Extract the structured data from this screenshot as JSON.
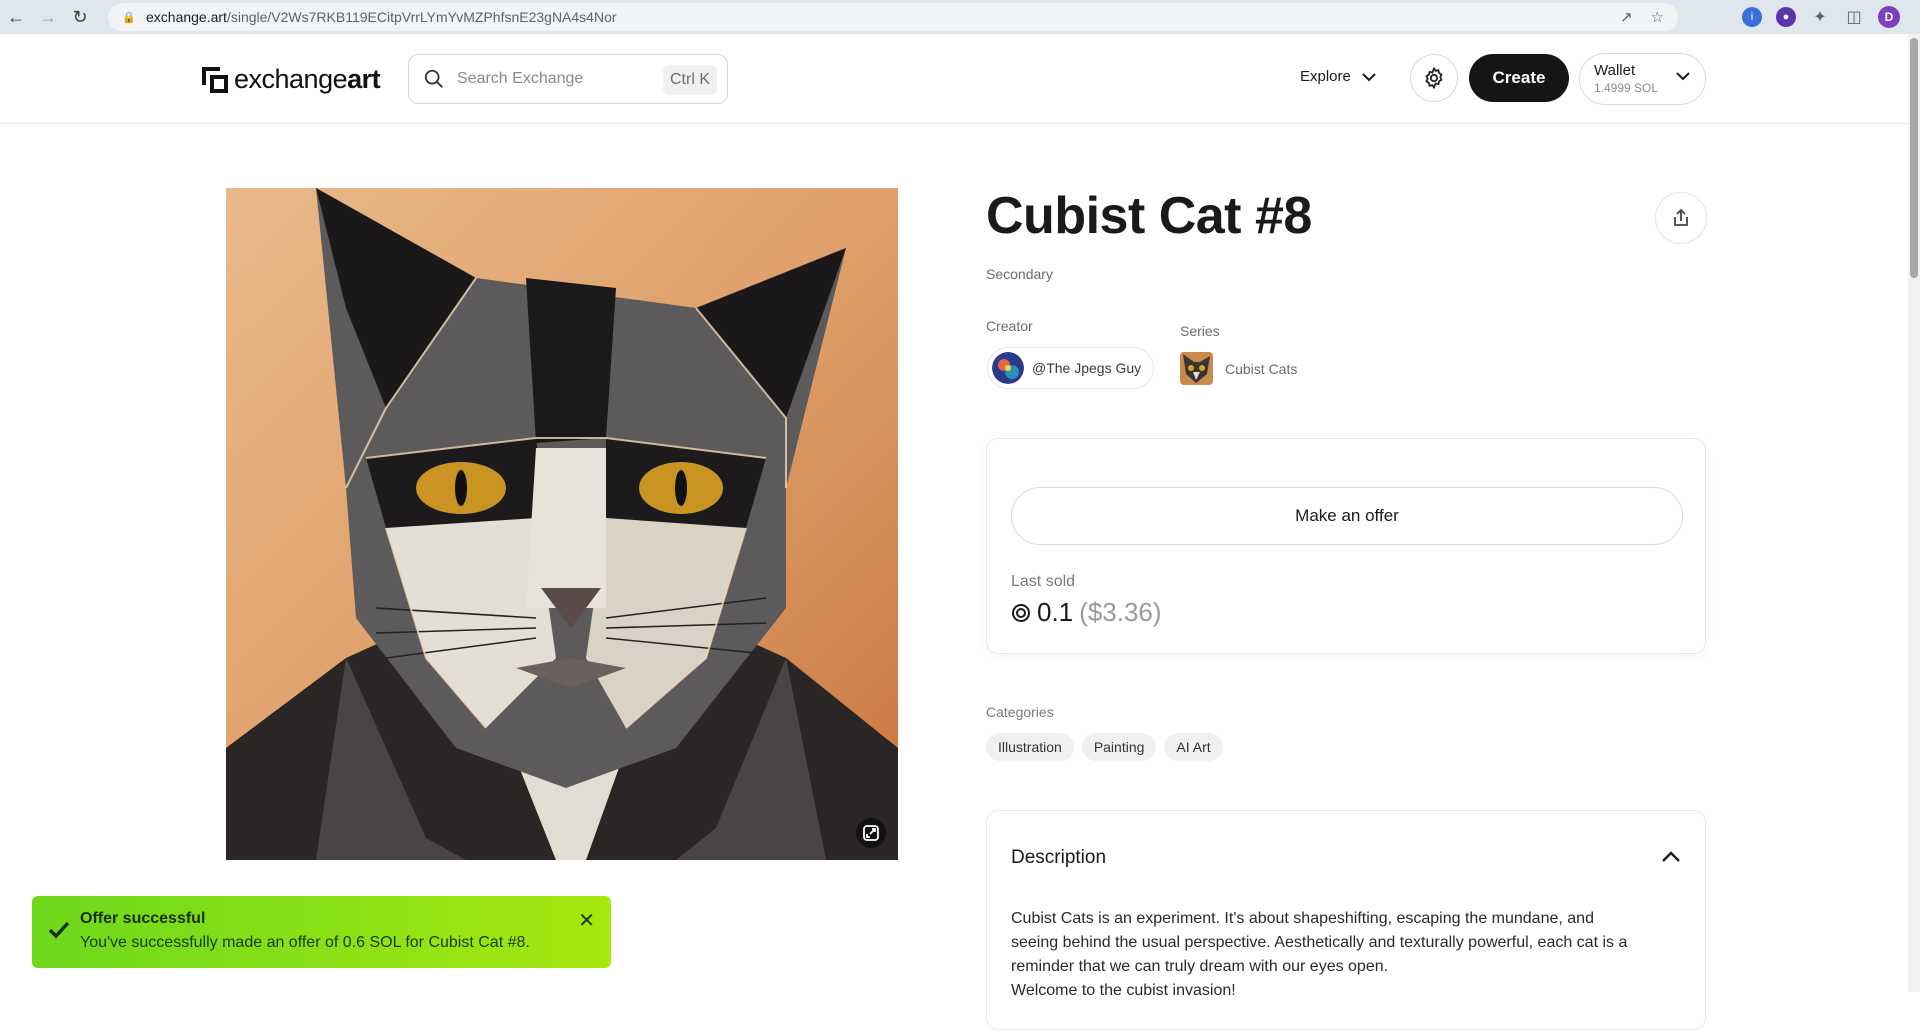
{
  "browser": {
    "url_host": "exchange.art",
    "url_path": "/single/V2Ws7RKB119ECitpVrrLYmYvMZPhfsnE23gNA4s4Nor",
    "profile_initial": "D"
  },
  "header": {
    "logo_light": "exchange",
    "logo_bold": "art",
    "search_placeholder": "Search Exchange",
    "search_shortcut": "Ctrl K",
    "explore_label": "Explore",
    "create_label": "Create",
    "wallet_label": "Wallet",
    "wallet_balance": "1.4999 SOL"
  },
  "artwork": {
    "title": "Cubist Cat #8",
    "market_type": "Secondary",
    "creator_label": "Creator",
    "creator_name": "@The Jpegs Guy",
    "series_label": "Series",
    "series_name": "Cubist Cats"
  },
  "offer": {
    "button_label": "Make an offer",
    "last_sold_label": "Last sold",
    "last_sold_sol": "0.1",
    "last_sold_usd": "($3.36)"
  },
  "categories": {
    "label": "Categories",
    "items": [
      "Illustration",
      "Painting",
      "AI Art"
    ]
  },
  "description": {
    "heading": "Description",
    "line1": "Cubist Cats is an experiment. It's about shapeshifting, escaping the mundane, and",
    "line2": "seeing behind the usual perspective. Aesthetically and texturally powerful, each cat is a",
    "line3": "reminder that we can truly dream with our eyes open.",
    "line4": "Welcome to the cubist invasion!"
  },
  "toast": {
    "title": "Offer successful",
    "message": "You've successfully made an offer of 0.6 SOL for Cubist Cat #8."
  },
  "icons": {
    "search": "search-icon",
    "gear": "gear-icon",
    "share": "share-icon",
    "expand": "expand-icon",
    "check": "check-icon",
    "close": "close-icon"
  },
  "colors": {
    "toast_start": "#6dd81d",
    "toast_end": "#a6e80f",
    "create_bg": "#151515"
  }
}
